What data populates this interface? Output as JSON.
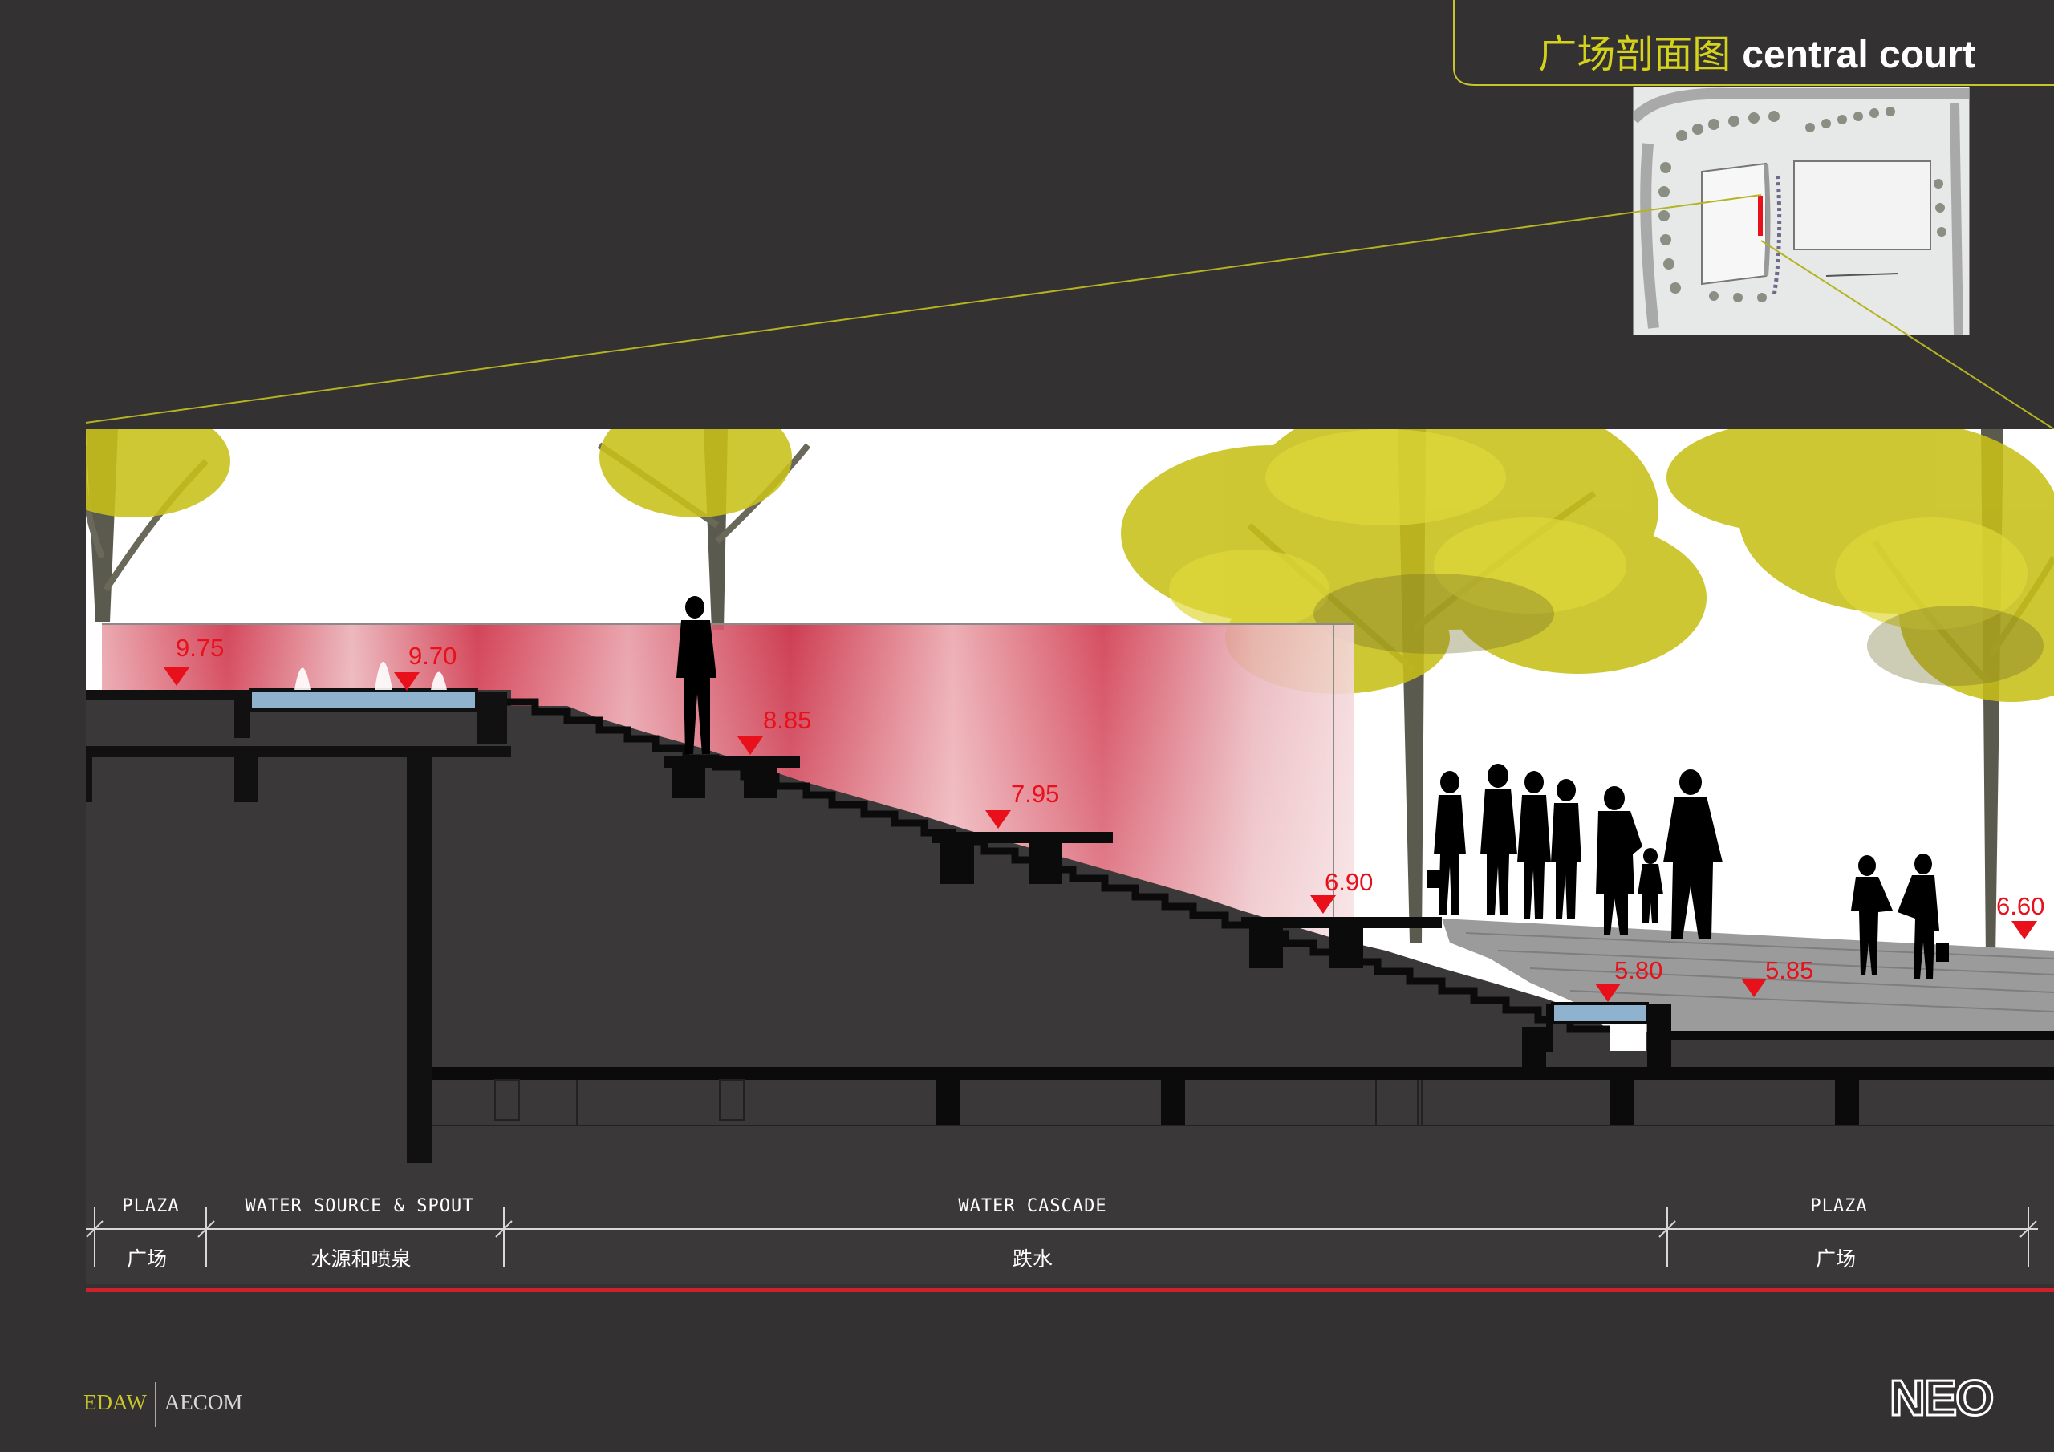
{
  "header": {
    "title_cn": "广场剖面图",
    "title_en": "central court"
  },
  "colors": {
    "background": "#333132",
    "accent_yellow": "#d4d21a",
    "elevation_red": "#e8101a",
    "divider_red": "#d0202a",
    "water_blue": "#8fb3cf"
  },
  "elevations": [
    "9.75",
    "9.70",
    "8.85",
    "7.95",
    "6.90",
    "5.80",
    "5.85",
    "6.60"
  ],
  "zones": [
    {
      "label_en": "PLAZA",
      "label_cn": "广场"
    },
    {
      "label_en": "WATER SOURCE & SPOUT",
      "label_cn": "水源和喷泉"
    },
    {
      "label_en": "WATER CASCADE",
      "label_cn": "跌水"
    },
    {
      "label_en": "PLAZA",
      "label_cn": "广场"
    }
  ],
  "footer": {
    "logo_left": "EDAW",
    "logo_right": "AECOM",
    "brand": "NEO"
  }
}
